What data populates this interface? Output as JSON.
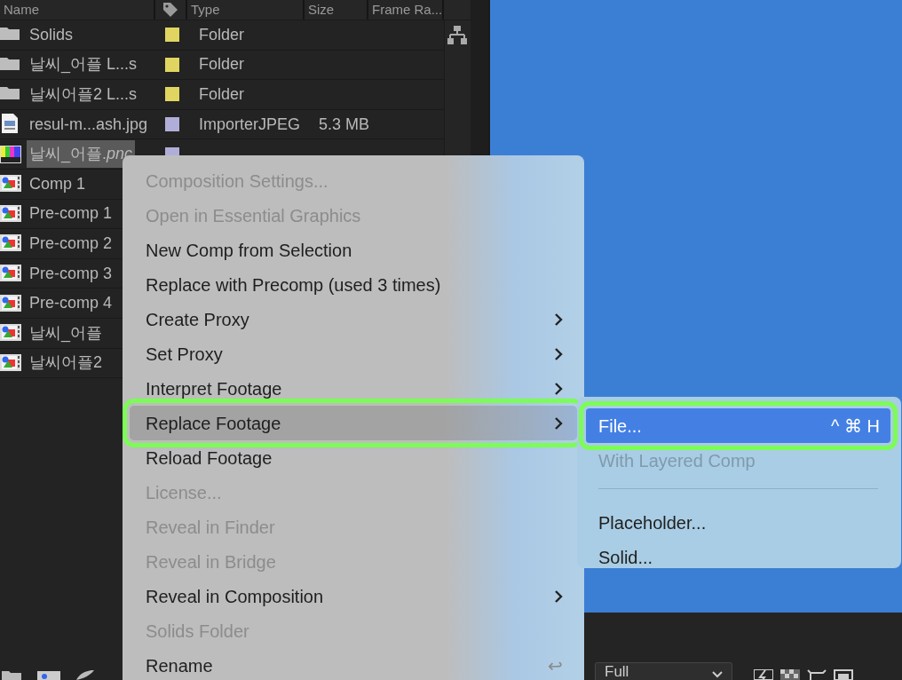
{
  "project_panel": {
    "columns": [
      "Name",
      "Type",
      "Size",
      "Frame Ra..."
    ],
    "rows": [
      {
        "name": "Solids",
        "kind": "folder",
        "color": "#e0d560",
        "type": "Folder",
        "selected": false
      },
      {
        "name": "날씨_어플 L...s",
        "kind": "folder",
        "color": "#e0d560",
        "type": "Folder",
        "selected": false
      },
      {
        "name": "날씨어플2 L...s",
        "kind": "folder",
        "color": "#e0d560",
        "type": "Folder",
        "selected": false
      },
      {
        "name": "resul-m...ash.jpg",
        "kind": "image",
        "color": "#b0aed8",
        "type": "ImporterJPEG",
        "size": "5.3 MB",
        "selected": false
      },
      {
        "name": "날씨_어플.*pnc*",
        "kind": "png",
        "color": "#b0aed8",
        "selected": true
      },
      {
        "name": "Comp 1",
        "kind": "comp",
        "selected": false
      },
      {
        "name": "Pre-comp 1",
        "kind": "comp",
        "selected": false
      },
      {
        "name": "Pre-comp 2",
        "kind": "comp",
        "selected": false
      },
      {
        "name": "Pre-comp 3",
        "kind": "comp",
        "selected": false
      },
      {
        "name": "Pre-comp 4",
        "kind": "comp",
        "selected": false
      },
      {
        "name": "날씨_어플",
        "kind": "comp",
        "selected": false
      },
      {
        "name": "날씨어플2",
        "kind": "comp",
        "selected": false
      }
    ]
  },
  "viewer_toolbar": {
    "resolution": "Full"
  },
  "context_menu": {
    "items": [
      {
        "label": "Composition Settings...",
        "disabled": true,
        "submenu": false,
        "selected": false,
        "annotated": false
      },
      {
        "label": "Open in Essential Graphics",
        "disabled": true,
        "submenu": false,
        "selected": false,
        "annotated": false
      },
      {
        "label": "New Comp from Selection",
        "disabled": false,
        "submenu": false,
        "selected": false,
        "annotated": false
      },
      {
        "label": "Replace with Precomp (used 3 times)",
        "disabled": false,
        "submenu": false,
        "selected": false,
        "annotated": false
      },
      {
        "label": "Create Proxy",
        "disabled": false,
        "submenu": true,
        "selected": false,
        "annotated": false
      },
      {
        "label": "Set Proxy",
        "disabled": false,
        "submenu": true,
        "selected": false,
        "annotated": false
      },
      {
        "label": "Interpret Footage",
        "disabled": false,
        "submenu": true,
        "selected": false,
        "annotated": false
      },
      {
        "label": "Replace Footage",
        "disabled": false,
        "submenu": true,
        "selected": true,
        "annotated": true
      },
      {
        "label": "Reload Footage",
        "disabled": false,
        "submenu": false,
        "selected": false,
        "annotated": false
      },
      {
        "label": "License...",
        "disabled": true,
        "submenu": false,
        "selected": false,
        "annotated": false
      },
      {
        "label": "Reveal in Finder",
        "disabled": true,
        "submenu": false,
        "selected": false,
        "annotated": false
      },
      {
        "label": "Reveal in Bridge",
        "disabled": true,
        "submenu": false,
        "selected": false,
        "annotated": false
      },
      {
        "label": "Reveal in Composition",
        "disabled": false,
        "submenu": true,
        "selected": false,
        "annotated": false
      },
      {
        "label": "Solids Folder",
        "disabled": true,
        "submenu": false,
        "selected": false,
        "annotated": false
      },
      {
        "label": "Rename",
        "disabled": false,
        "submenu": false,
        "selected": false,
        "annotated": false,
        "shortcut": "↩"
      }
    ]
  },
  "submenu": {
    "items": [
      {
        "kind": "item",
        "label": "File...",
        "shortcut": "^ ⌘ H",
        "disabled": false,
        "selected": true,
        "annotated": true
      },
      {
        "kind": "item",
        "label": "With Layered Comp",
        "disabled": true,
        "selected": false,
        "annotated": false
      },
      {
        "kind": "separator"
      },
      {
        "kind": "item",
        "label": "Placeholder...",
        "disabled": false,
        "selected": false,
        "annotated": false
      },
      {
        "kind": "item",
        "label": "Solid...",
        "disabled": false,
        "selected": false,
        "annotated": false
      }
    ]
  }
}
